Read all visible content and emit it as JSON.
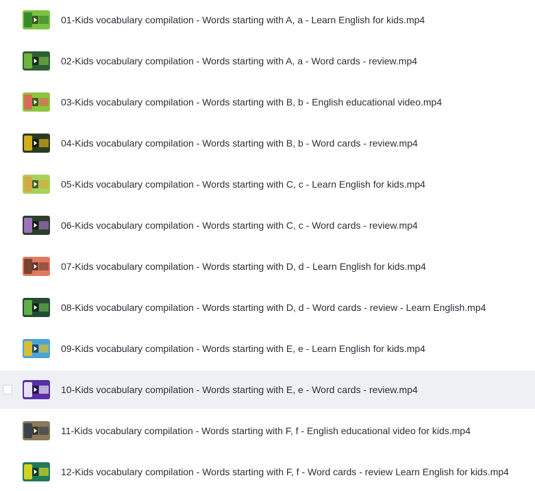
{
  "files": [
    {
      "name": "01-Kids vocabulary compilation - Words starting with A, a - Learn English for kids.mp4",
      "thumb_icon": "video-thumbnail-icon",
      "thumb_bg": "#7cc242",
      "thumb_accent": "#2f7d2a",
      "selected": false
    },
    {
      "name": "02-Kids vocabulary compilation - Words starting with A, a - Word cards - review.mp4",
      "thumb_icon": "video-thumbnail-icon",
      "thumb_bg": "#2f5e34",
      "thumb_accent": "#7cc242",
      "selected": false
    },
    {
      "name": "03-Kids vocabulary compilation - Words starting with B, b - English educational video.mp4",
      "thumb_icon": "video-thumbnail-icon",
      "thumb_bg": "#8cc63f",
      "thumb_accent": "#e85a5a",
      "selected": false
    },
    {
      "name": "04-Kids vocabulary compilation - Words starting with B, b - Word cards - review.mp4",
      "thumb_icon": "video-thumbnail-icon",
      "thumb_bg": "#2a3a22",
      "thumb_accent": "#f2c21a",
      "selected": false
    },
    {
      "name": "05-Kids vocabulary compilation - Words starting with C, c - Learn English for kids.mp4",
      "thumb_icon": "video-thumbnail-icon",
      "thumb_bg": "#a8d15a",
      "thumb_accent": "#d9a441",
      "selected": false
    },
    {
      "name": "06-Kids vocabulary compilation - Words starting with C, c - Word cards - review.mp4",
      "thumb_icon": "video-thumbnail-icon",
      "thumb_bg": "#2c3e2c",
      "thumb_accent": "#b27bd6",
      "selected": false
    },
    {
      "name": "07-Kids vocabulary compilation - Words starting with D, d - Learn English for kids.mp4",
      "thumb_icon": "video-thumbnail-icon",
      "thumb_bg": "#e07a5f",
      "thumb_accent": "#6b3a2a",
      "selected": false
    },
    {
      "name": "08-Kids vocabulary compilation - Words starting with D, d - Word cards - review - Learn English.mp4",
      "thumb_icon": "video-thumbnail-icon",
      "thumb_bg": "#244a35",
      "thumb_accent": "#6fc04a",
      "selected": false
    },
    {
      "name": "09-Kids vocabulary compilation - Words starting with E, e - Learn English for kids.mp4",
      "thumb_icon": "video-thumbnail-icon",
      "thumb_bg": "#4aa3d8",
      "thumb_accent": "#f2c21a",
      "selected": false
    },
    {
      "name": "10-Kids vocabulary compilation - Words starting with E, e - Word cards - review.mp4",
      "thumb_icon": "video-thumbnail-icon",
      "thumb_bg": "#5a2ea6",
      "thumb_accent": "#ffffff",
      "selected": true
    },
    {
      "name": "11-Kids vocabulary compilation - Words starting with F, f - English educational video for kids.mp4",
      "thumb_icon": "video-thumbnail-icon",
      "thumb_bg": "#8a7a5a",
      "thumb_accent": "#2c3a4a",
      "selected": false
    },
    {
      "name": "12-Kids vocabulary compilation - Words starting with F, f - Word cards - review Learn English for kids.mp4",
      "thumb_icon": "video-thumbnail-icon",
      "thumb_bg": "#1f7a5a",
      "thumb_accent": "#f2e21a",
      "selected": false
    }
  ],
  "colors": {
    "text": "#2b2f36",
    "selected_row_bg": "#eef0f4",
    "play_button": "#ffffff"
  }
}
